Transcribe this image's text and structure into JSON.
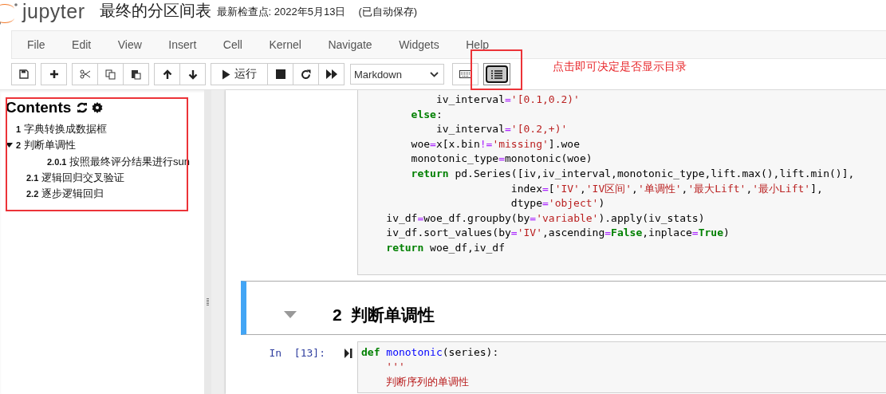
{
  "header": {
    "logo_text": "jupyter",
    "title": "最终的分区间表",
    "checkpoint": "最新检查点: 2022年5月13日",
    "autosave": "(已自动保存)"
  },
  "menu": [
    "File",
    "Edit",
    "View",
    "Insert",
    "Cell",
    "Kernel",
    "Navigate",
    "Widgets",
    "Help"
  ],
  "toolbar": [
    [
      {
        "kind": "save",
        "selected": false
      }
    ],
    [
      {
        "kind": "add",
        "selected": false
      }
    ],
    [
      {
        "kind": "cut",
        "selected": false
      },
      {
        "kind": "copy",
        "selected": false
      },
      {
        "kind": "paste",
        "selected": false
      }
    ],
    [
      {
        "kind": "up",
        "selected": false
      },
      {
        "kind": "down",
        "selected": false
      }
    ],
    [
      {
        "kind": "run",
        "label": "运行",
        "selected": false
      },
      {
        "kind": "stop",
        "selected": false
      },
      {
        "kind": "restart",
        "selected": false
      },
      {
        "kind": "fastforward",
        "selected": false
      }
    ],
    [
      {
        "kind": "celltype",
        "value": "Markdown"
      }
    ],
    [
      {
        "kind": "keyboard",
        "selected": false
      }
    ],
    [
      {
        "kind": "toc",
        "selected": true
      }
    ]
  ],
  "annotation": {
    "text": "点击即可决定是否显示目录"
  },
  "toc": {
    "title": "Contents",
    "items": [
      {
        "num": "1",
        "text": "字典转换成数据框"
      },
      {
        "num": "2",
        "text": "判断单调性",
        "expanded": true,
        "children": [
          {
            "children": [
              {
                "num": "2.0.1",
                "text": "按照最终评分结果进行sun"
              }
            ]
          },
          {
            "num": "2.1",
            "text": "逻辑回归交叉验证"
          },
          {
            "num": "2.2",
            "text": "逐步逻辑回归"
          }
        ]
      }
    ]
  },
  "cells": [
    {
      "kind": "code",
      "lines": [
        [
          {
            "kind": "plain",
            "t": "            iv_interval"
          },
          {
            "kind": "op",
            "t": "="
          },
          {
            "kind": "str",
            "t": "'[0.1,0.2)'"
          }
        ],
        [
          {
            "kind": "kw",
            "t": "        else"
          },
          {
            "kind": "plain",
            "t": ":"
          }
        ],
        [
          {
            "kind": "plain",
            "t": "            iv_interval"
          },
          {
            "kind": "op",
            "t": "="
          },
          {
            "kind": "str",
            "t": "'[0.2,+)'"
          }
        ],
        [
          {
            "kind": "plain",
            "t": "        woe"
          },
          {
            "kind": "op",
            "t": "="
          },
          {
            "kind": "plain",
            "t": "x[x.bin"
          },
          {
            "kind": "op",
            "t": "!="
          },
          {
            "kind": "str",
            "t": "'missing'"
          },
          {
            "kind": "plain",
            "t": "].woe"
          }
        ],
        [
          {
            "kind": "plain",
            "t": "        monotonic_type"
          },
          {
            "kind": "op",
            "t": "="
          },
          {
            "kind": "plain",
            "t": "monotonic(woe)"
          }
        ],
        [
          {
            "kind": "kw",
            "t": "        return"
          },
          {
            "kind": "plain",
            "t": " pd.Series([iv,iv_interval,monotonic_type,lift.max(),lift.min()],"
          }
        ],
        [
          {
            "kind": "plain",
            "t": "                        index"
          },
          {
            "kind": "op",
            "t": "="
          },
          {
            "kind": "plain",
            "t": "["
          },
          {
            "kind": "str",
            "t": "'IV'"
          },
          {
            "kind": "plain",
            "t": ","
          },
          {
            "kind": "str",
            "t": "'IV区间'"
          },
          {
            "kind": "plain",
            "t": ","
          },
          {
            "kind": "str",
            "t": "'单调性'"
          },
          {
            "kind": "plain",
            "t": ","
          },
          {
            "kind": "str",
            "t": "'最大Lift'"
          },
          {
            "kind": "plain",
            "t": ","
          },
          {
            "kind": "str",
            "t": "'最小Lift'"
          },
          {
            "kind": "plain",
            "t": "],"
          }
        ],
        [
          {
            "kind": "plain",
            "t": "                        dtype"
          },
          {
            "kind": "op",
            "t": "="
          },
          {
            "kind": "str",
            "t": "'object'"
          },
          {
            "kind": "plain",
            "t": ")"
          }
        ],
        [
          {
            "kind": "plain",
            "t": "    iv_df"
          },
          {
            "kind": "op",
            "t": "="
          },
          {
            "kind": "plain",
            "t": "woe_df.groupby(by"
          },
          {
            "kind": "op",
            "t": "="
          },
          {
            "kind": "str",
            "t": "'variable'"
          },
          {
            "kind": "plain",
            "t": ").apply(iv_stats)"
          }
        ],
        [
          {
            "kind": "plain",
            "t": "    iv_df.sort_values(by"
          },
          {
            "kind": "op",
            "t": "="
          },
          {
            "kind": "str",
            "t": "'IV'"
          },
          {
            "kind": "plain",
            "t": ",ascending"
          },
          {
            "kind": "op",
            "t": "="
          },
          {
            "kind": "kw",
            "t": "False"
          },
          {
            "kind": "plain",
            "t": ",inplace"
          },
          {
            "kind": "op",
            "t": "="
          },
          {
            "kind": "kw",
            "t": "True"
          },
          {
            "kind": "plain",
            "t": ")"
          }
        ],
        [
          {
            "kind": "kw",
            "t": "    return"
          },
          {
            "kind": "plain",
            "t": " woe_df,iv_df"
          }
        ]
      ]
    },
    {
      "kind": "markdown",
      "selected": true,
      "num": "2",
      "heading": "判断单调性"
    },
    {
      "kind": "code",
      "prompt": "In  [13]:",
      "lines": [
        [
          {
            "kind": "kw",
            "t": "def"
          },
          {
            "kind": "fn",
            "t": " monotonic"
          },
          {
            "kind": "plain",
            "t": "(series):"
          }
        ],
        [
          {
            "kind": "str",
            "t": "    '''"
          }
        ],
        [
          {
            "kind": "str",
            "t": "    判断序列的单调性"
          }
        ]
      ]
    }
  ]
}
